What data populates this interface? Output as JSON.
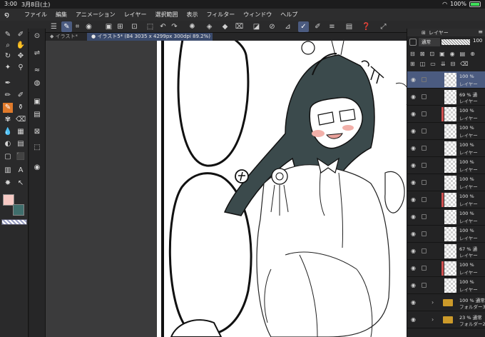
{
  "status": {
    "time": "3:00",
    "date": "3月8日(土)",
    "battery": "100%"
  },
  "menu": {
    "items": [
      "ファイル",
      "編集",
      "アニメーション",
      "レイヤー",
      "選択範囲",
      "表示",
      "フィルター",
      "ウィンドウ",
      "ヘルプ"
    ]
  },
  "tabs": [
    {
      "label": "イラスト*"
    },
    {
      "label": "イラスト5* (B4 3035 x 4299px 300dpi 89.2%)"
    }
  ],
  "colors": {
    "main": "#f6c9c4",
    "sub": "#3f6e6c",
    "accent": "#e07a2b",
    "selected": "#4b5b80"
  },
  "layer_panel": {
    "title": "レイヤー",
    "blend": "通常",
    "opacity": "100",
    "layers": [
      {
        "pct": "100 %",
        "name": "レイヤー",
        "clip": false,
        "sel": true
      },
      {
        "pct": "69 % 通",
        "name": "レイヤー",
        "clip": false,
        "sel": false
      },
      {
        "pct": "100 %",
        "name": "レイヤー",
        "clip": true,
        "sel": false
      },
      {
        "pct": "100 %",
        "name": "レイヤー",
        "clip": false,
        "sel": false
      },
      {
        "pct": "100 %",
        "name": "レイヤー",
        "clip": false,
        "sel": false
      },
      {
        "pct": "100 %",
        "name": "レイヤー",
        "clip": false,
        "sel": false
      },
      {
        "pct": "100 %",
        "name": "レイヤー",
        "clip": false,
        "sel": false
      },
      {
        "pct": "100 %",
        "name": "レイヤー",
        "clip": true,
        "sel": false
      },
      {
        "pct": "100 %",
        "name": "レイヤー",
        "clip": false,
        "sel": false
      },
      {
        "pct": "100 %",
        "name": "レイヤー",
        "clip": false,
        "sel": false
      },
      {
        "pct": "67 % 通",
        "name": "レイヤー",
        "clip": false,
        "sel": false
      },
      {
        "pct": "100 %",
        "name": "レイヤー",
        "clip": true,
        "sel": false
      },
      {
        "pct": "100 %",
        "name": "レイヤー",
        "clip": false,
        "sel": false
      }
    ],
    "folders": [
      {
        "pct": "100 % 通常",
        "name": "フォルダー3"
      },
      {
        "pct": "23 % 通常",
        "name": "フォルダー2"
      }
    ]
  },
  "icons": {
    "tools": [
      "pen-tool",
      "brush-tool",
      "zoom-icon",
      "hand-icon",
      "move-icon",
      "select-icon",
      "eyedropper-icon",
      "pen-icon",
      "fill-icon",
      "eraser-icon",
      "text-icon",
      "shape-icon"
    ]
  }
}
